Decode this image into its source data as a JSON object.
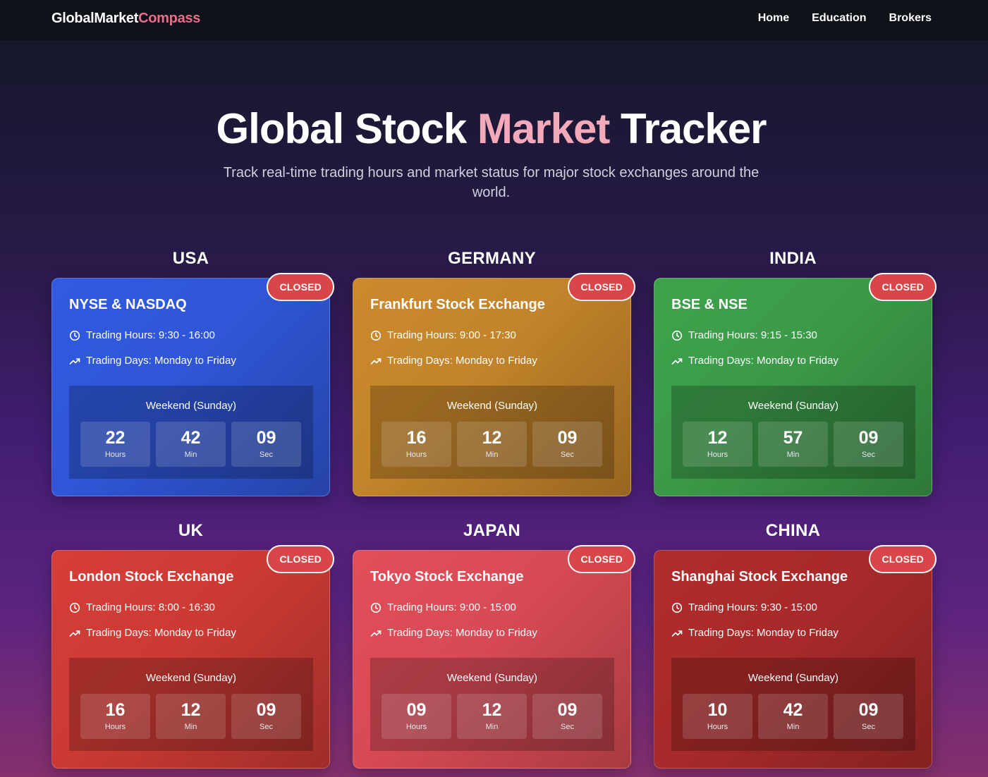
{
  "nav": {
    "brand_primary": "GlobalMarket",
    "brand_accent": "Compass",
    "links": [
      "Home",
      "Education",
      "Brokers"
    ]
  },
  "hero": {
    "title_part1": "Global Stock ",
    "title_accent": "Market",
    "title_part2": " Tracker",
    "subtitle": "Track real-time trading hours and market status for major stock exchanges around the world."
  },
  "markets": [
    {
      "country": "USA",
      "name": "NYSE & NASDAQ",
      "status": "CLOSED",
      "hours": "Trading Hours: 9:30 - 16:00",
      "days": "Trading Days: Monday to Friday",
      "countdown_label": "Weekend (Sunday)",
      "hours_left": "22",
      "min_left": "42",
      "sec_left": "09",
      "unit_hours": "Hours",
      "unit_min": "Min",
      "unit_sec": "Sec",
      "color": "#2f56d6"
    },
    {
      "country": "GERMANY",
      "name": "Frankfurt Stock Exchange",
      "status": "CLOSED",
      "hours": "Trading Hours: 9:00 - 17:30",
      "days": "Trading Days: Monday to Friday",
      "countdown_label": "Weekend (Sunday)",
      "hours_left": "16",
      "min_left": "12",
      "sec_left": "09",
      "unit_hours": "Hours",
      "unit_min": "Min",
      "unit_sec": "Sec",
      "color": "#c2832a"
    },
    {
      "country": "INDIA",
      "name": "BSE & NSE",
      "status": "CLOSED",
      "hours": "Trading Hours: 9:15 - 15:30",
      "days": "Trading Days: Monday to Friday",
      "countdown_label": "Weekend (Sunday)",
      "hours_left": "12",
      "min_left": "57",
      "sec_left": "09",
      "unit_hours": "Hours",
      "unit_min": "Min",
      "unit_sec": "Sec",
      "color": "#3b9a48"
    },
    {
      "country": "UK",
      "name": "London Stock Exchange",
      "status": "CLOSED",
      "hours": "Trading Hours: 8:00 - 16:30",
      "days": "Trading Days: Monday to Friday",
      "countdown_label": "Weekend (Sunday)",
      "hours_left": "16",
      "min_left": "12",
      "sec_left": "09",
      "unit_hours": "Hours",
      "unit_min": "Min",
      "unit_sec": "Sec",
      "color": "#cc3a34"
    },
    {
      "country": "JAPAN",
      "name": "Tokyo Stock Exchange",
      "status": "CLOSED",
      "hours": "Trading Hours: 9:00 - 15:00",
      "days": "Trading Days: Monday to Friday",
      "countdown_label": "Weekend (Sunday)",
      "hours_left": "09",
      "min_left": "12",
      "sec_left": "09",
      "unit_hours": "Hours",
      "unit_min": "Min",
      "unit_sec": "Sec",
      "color": "#d74a55"
    },
    {
      "country": "CHINA",
      "name": "Shanghai Stock Exchange",
      "status": "CLOSED",
      "hours": "Trading Hours: 9:30 - 15:00",
      "days": "Trading Days: Monday to Friday",
      "countdown_label": "Weekend (Sunday)",
      "hours_left": "10",
      "min_left": "42",
      "sec_left": "09",
      "unit_hours": "Hours",
      "unit_min": "Min",
      "unit_sec": "Sec",
      "color": "#a82a2a"
    }
  ]
}
